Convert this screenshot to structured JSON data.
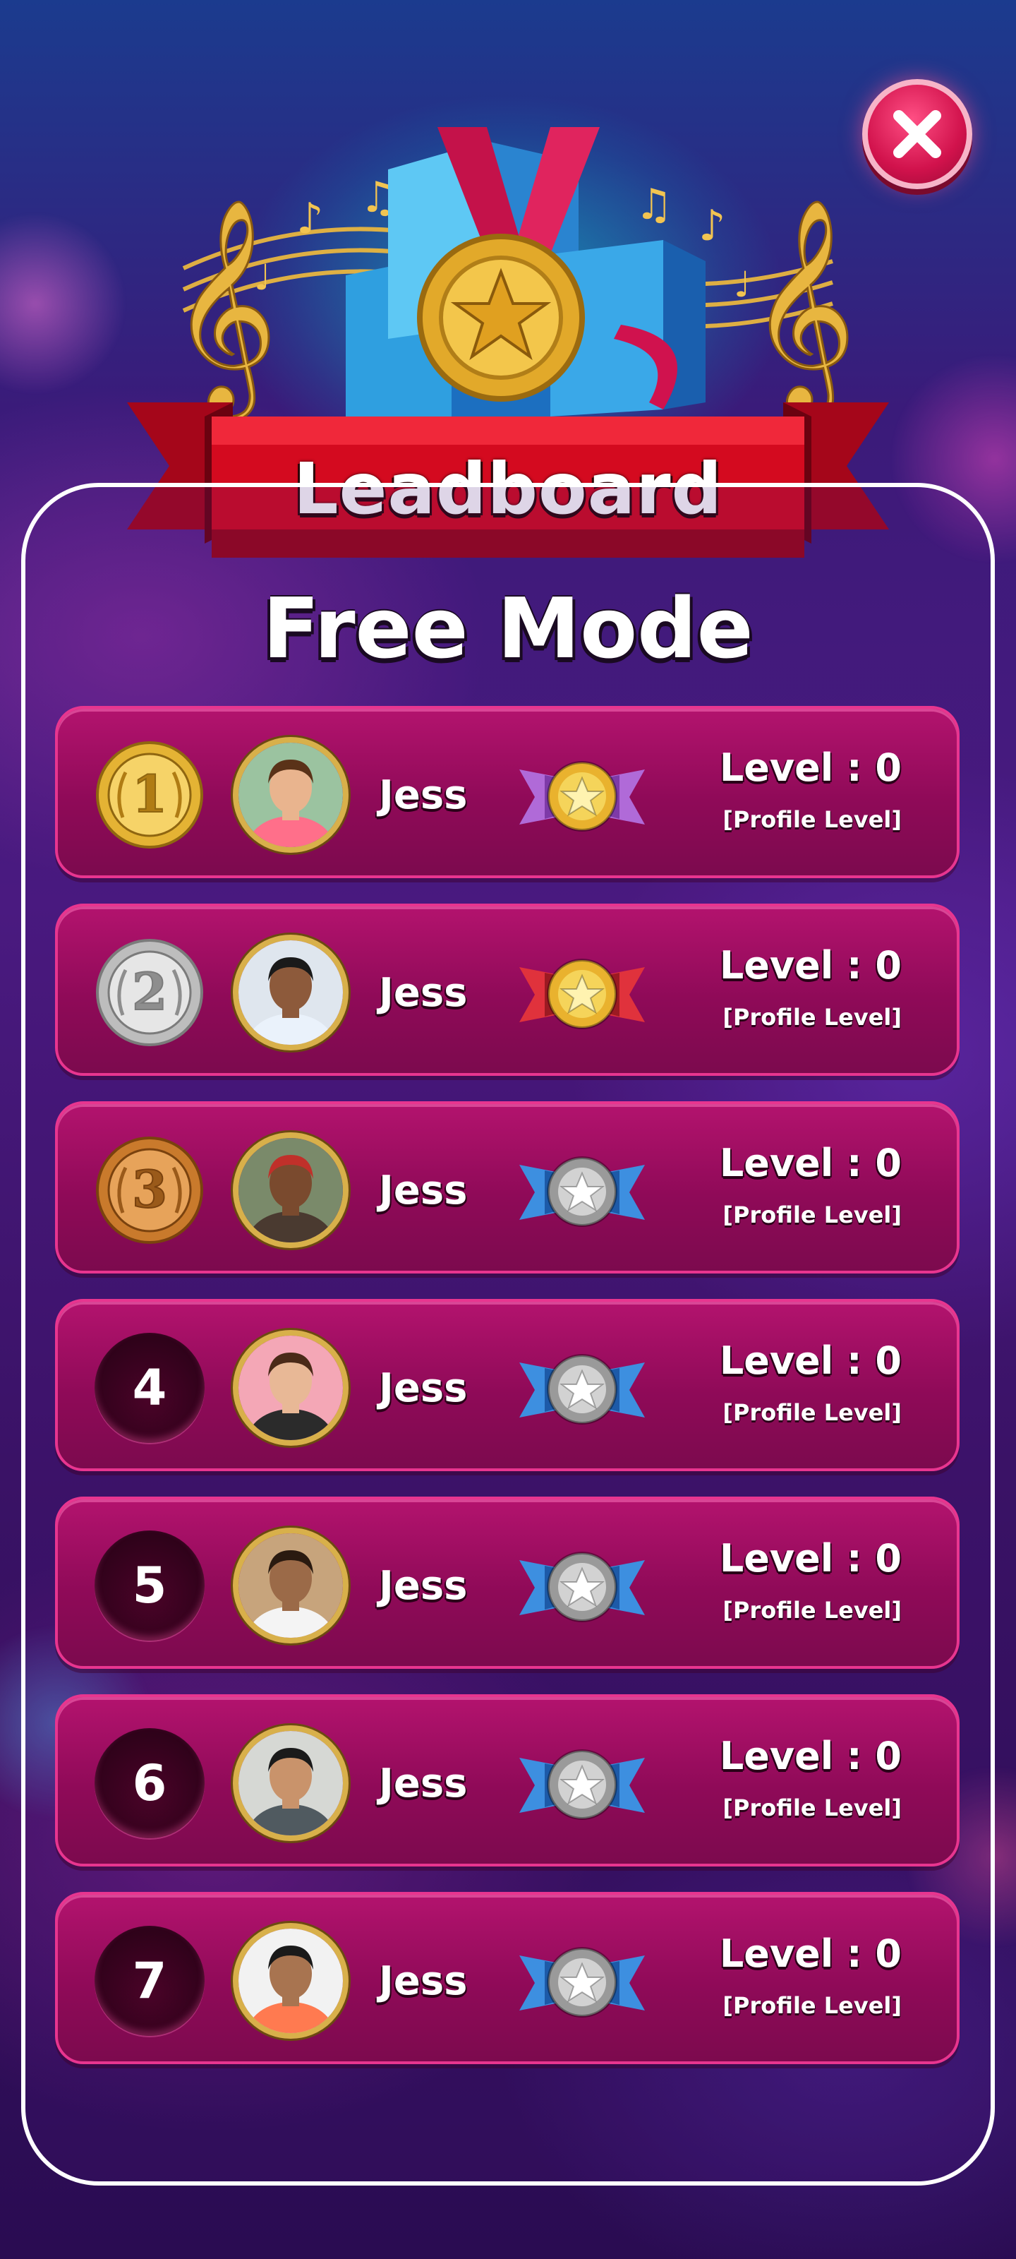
{
  "header": {
    "title": "Leadboard",
    "subtitle": "Free Mode"
  },
  "colors": {
    "row_fill": "#8f0a58",
    "row_border": "#e8358f",
    "gold": "#e4b334",
    "silver": "#c9c9c9",
    "bronze": "#d38a38",
    "close_button": "#d1124c",
    "ribbon": "#d10a1e"
  },
  "icons": {
    "close": "close-icon",
    "medal": "medal-trophy-icon",
    "rank_gold": "gold-medal-icon",
    "rank_silver": "silver-medal-icon",
    "rank_bronze": "bronze-medal-icon",
    "badge_gold": "gold-star-badge-icon",
    "badge_red": "red-star-badge-icon",
    "badge_blue": "blue-star-badge-icon"
  },
  "leaderboard": [
    {
      "rank": "1",
      "rank_style": "gold",
      "name": "Jess",
      "badge": "gold",
      "level": "Level : 0",
      "level_note": "[Profile Level]"
    },
    {
      "rank": "2",
      "rank_style": "silver",
      "name": "Jess",
      "badge": "red",
      "level": "Level : 0",
      "level_note": "[Profile Level]"
    },
    {
      "rank": "3",
      "rank_style": "bronze",
      "name": "Jess",
      "badge": "blue",
      "level": "Level : 0",
      "level_note": "[Profile Level]"
    },
    {
      "rank": "4",
      "rank_style": "plain",
      "name": "Jess",
      "badge": "blue",
      "level": "Level : 0",
      "level_note": "[Profile Level]"
    },
    {
      "rank": "5",
      "rank_style": "plain",
      "name": "Jess",
      "badge": "blue",
      "level": "Level : 0",
      "level_note": "[Profile Level]"
    },
    {
      "rank": "6",
      "rank_style": "plain",
      "name": "Jess",
      "badge": "blue",
      "level": "Level : 0",
      "level_note": "[Profile Level]"
    },
    {
      "rank": "7",
      "rank_style": "plain",
      "name": "Jess",
      "badge": "blue",
      "level": "Level : 0",
      "level_note": "[Profile Level]"
    }
  ]
}
